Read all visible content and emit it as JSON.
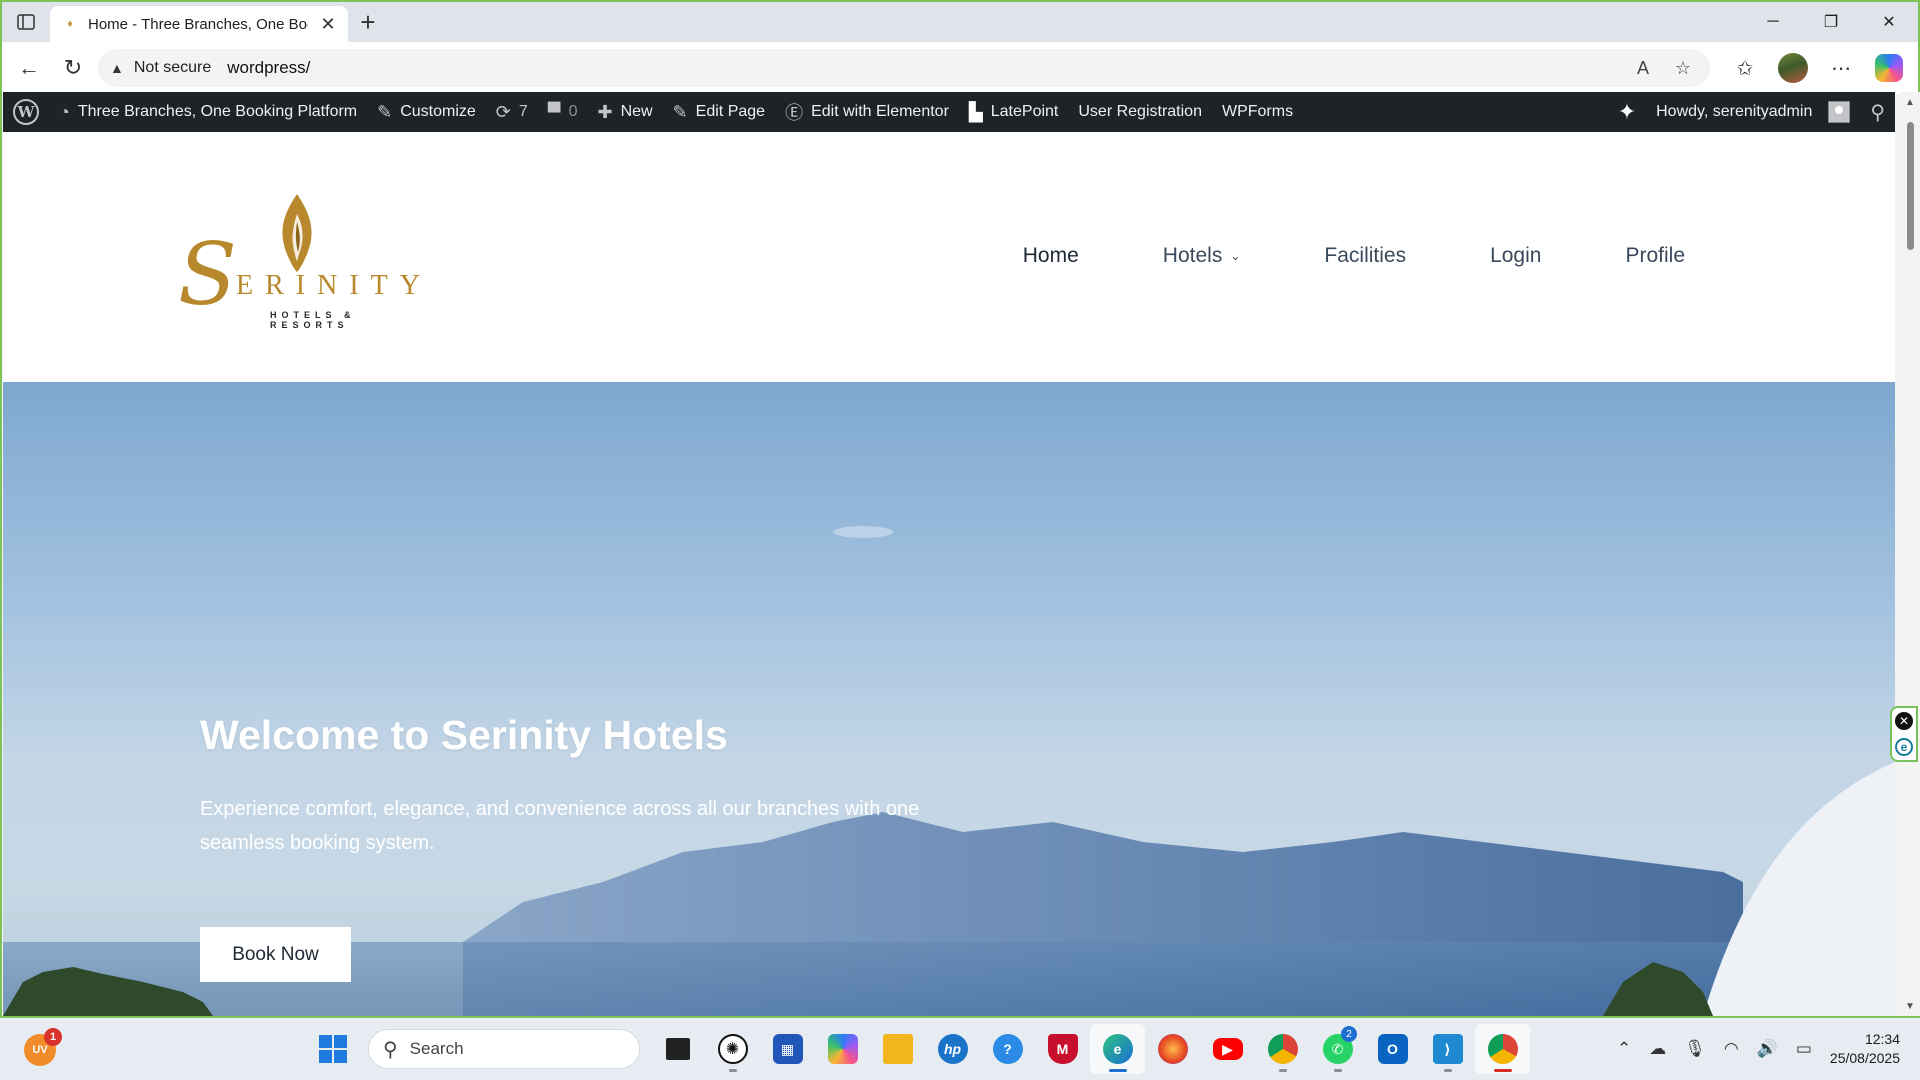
{
  "browser": {
    "tab_title": "Home - Three Branches, One Booking Platform",
    "tab_title_visible": "Home - Three Branches, One Boo",
    "security_label": "Not secure",
    "url": "wordpress/"
  },
  "wp_admin_bar": {
    "site_name": "Three Branches, One Booking Platform",
    "customize": "Customize",
    "updates_count": "7",
    "comments_count": "0",
    "new": "New",
    "edit_page": "Edit Page",
    "edit_elementor": "Edit with Elementor",
    "latepoint": "LatePoint",
    "user_registration": "User Registration",
    "wpforms": "WPForms",
    "howdy": "Howdy, serenityadmin"
  },
  "site": {
    "logo_letter": "S",
    "logo_name": "ERINITY",
    "logo_tagline": "HOTELS & RESORTS",
    "menu": [
      {
        "label": "Home"
      },
      {
        "label": "Hotels"
      },
      {
        "label": "Facilities"
      },
      {
        "label": "Login"
      },
      {
        "label": "Profile"
      }
    ]
  },
  "hero": {
    "heading": "Welcome to Serinity Hotels",
    "text": "Experience comfort, elegance, and convenience across all our branches with one seamless booking system.",
    "button": "Book Now"
  },
  "taskbar": {
    "weather_badge": "1",
    "weather_label": "UV",
    "search_placeholder": "Search",
    "whatsapp_count": "2",
    "time": "12:34",
    "date": "25/08/2025"
  },
  "colors": {
    "accent_gold": "#b8892c",
    "wp_bar": "#1d2327",
    "window_border": "#7dc35a"
  }
}
